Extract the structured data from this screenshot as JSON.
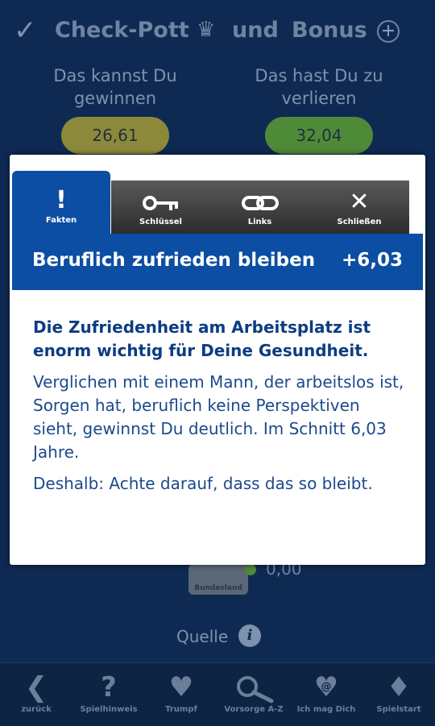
{
  "header": {
    "title": "Check-Pott",
    "und": "und",
    "bonus": "Bonus"
  },
  "columns": {
    "win_label": "Das kannst Du gewinnen",
    "lose_label": "Das hast Du zu verlieren",
    "win_value": "26,61",
    "lose_value": "32,04"
  },
  "background": {
    "bundesland": "Bundesland",
    "partial_value": "0,00",
    "quelle": "Quelle",
    "info_glyph": "i"
  },
  "dialog": {
    "tabs": [
      {
        "label": "Fakten",
        "icon": "exclamation-icon"
      },
      {
        "label": "Schlüssel",
        "icon": "key-icon"
      },
      {
        "label": "Links",
        "icon": "link-icon"
      },
      {
        "label": "Schließen",
        "icon": "close-icon"
      }
    ],
    "banner_title": "Beruflich zufrieden bleiben",
    "banner_value": "+6,03",
    "lead": "Die Zufriedenheit am Arbeitsplatz ist enorm wichtig für Deine Gesundheit.",
    "paragraph1": "Verglichen mit einem Mann, der arbeitslos ist, Sorgen hat, beruflich keine Perspektiven sieht, gewinnst Du deutlich. Im Schnitt 6,03 Jahre.",
    "paragraph2": "Deshalb: Achte darauf, dass das so bleibt."
  },
  "nav": [
    {
      "label": "zurück",
      "icon": "back-arrow-icon"
    },
    {
      "label": "Spielhinweis",
      "icon": "question-icon"
    },
    {
      "label": "Trumpf",
      "icon": "heart-icon"
    },
    {
      "label": "Vorsorge A-Z",
      "icon": "magnifier-icon"
    },
    {
      "label": "Ich mag Dich",
      "icon": "heart-at-icon"
    },
    {
      "label": "Spielstart",
      "icon": "diamond-icon"
    }
  ],
  "colors": {
    "background": "#0f2a52",
    "accent_blue": "#0c4ea3",
    "win_pill": "#8c8a3a",
    "lose_pill": "#4f8a38"
  }
}
